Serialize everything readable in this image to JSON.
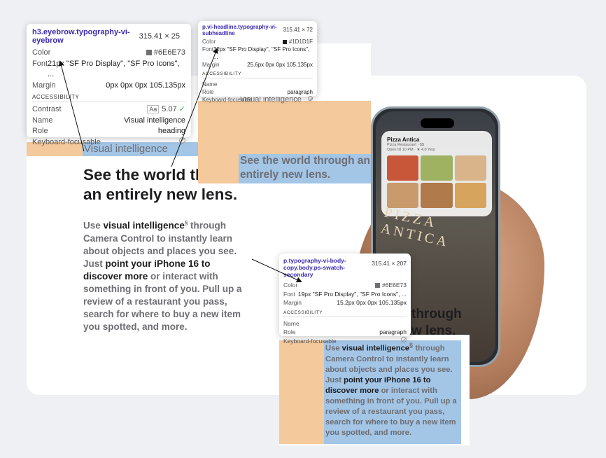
{
  "section": {
    "eyebrow": "Visual intelligence",
    "headline_line1": "See the world through",
    "headline_line2": "an entirely new lens.",
    "body": {
      "use": "Use ",
      "vi": "visual intelligence",
      "footnote": "§",
      "part2": " through Camera Control to instantly learn about objects and places you see. Just ",
      "point": "point your iPhone 16 to discover more",
      "part3": " or interact with something in front of you. Pull up a review of a restaurant you pass, search for where to buy a new item you spotted, and more."
    }
  },
  "phone": {
    "place_name": "Pizza Antica",
    "place_type": "Pizza Restaurant · $$",
    "place_hours": "Open till 10 PM · ★ 4.0 Yelp",
    "sign_text": "PIZZA ANTICA",
    "thumb_colors": [
      "#c8573a",
      "#9fb262",
      "#d9b48a",
      "#c99a6b",
      "#b07a4a",
      "#d7a45e"
    ]
  },
  "preview_head": {
    "eyebrow": "Visual intelligence",
    "headline": "See the world through an entirely new lens."
  },
  "behind_text": {
    "line1": "through",
    "line2": "w lens."
  },
  "tooltips": {
    "eyebrow": {
      "selector": "h3.eyebrow.typography-vi-eyebrow",
      "dims": "315.41 × 25",
      "color_label": "Color",
      "color_value": "#6E6E73",
      "color_hex": "#6E6E73",
      "font_label": "Font",
      "font_value": "21px \"SF Pro Display\", \"SF Pro Icons\", ...",
      "margin_label": "Margin",
      "margin_value": "0px 0px 0px 105.135px",
      "a11y": "ACCESSIBILITY",
      "contrast_label": "Contrast",
      "contrast_aa": "Aa",
      "contrast_value": "5.07",
      "name_label": "Name",
      "name_value": "Visual intelligence",
      "role_label": "Role",
      "role_value": "heading",
      "kbd_label": "Keyboard-focusable"
    },
    "headline": {
      "selector": "p.vi-headline.typography-vi-subheadline",
      "dims": "315.41 × 72",
      "color_label": "Color",
      "color_value": "#1D1D1F",
      "color_hex": "#1D1D1F",
      "font_label": "Font",
      "font_value": "32px \"SF Pro Display\", \"SF Pro Icons\", ...",
      "margin_label": "Margin",
      "margin_value": "25.6px 0px 0px 105.135px",
      "a11y": "ACCESSIBILITY",
      "name_label": "Name",
      "role_label": "Role",
      "role_value": "paragraph",
      "kbd_label": "Keyboard-focusable"
    },
    "body": {
      "selector": "p.typography-vi-body-copy.body.ps-swatch-secondary",
      "dims": "315.41 × 207",
      "color_label": "Color",
      "color_value": "#6E6E73",
      "color_hex": "#6E6E73",
      "font_label": "Font",
      "font_value": "19px \"SF Pro Display\", \"SF Pro Icons\", ...",
      "margin_label": "Margin",
      "margin_value": "15.2px 0px 0px 105.135px",
      "a11y": "ACCESSIBILITY",
      "name_label": "Name",
      "role_label": "Role",
      "role_value": "paragraph",
      "kbd_label": "Keyboard-focusable"
    }
  }
}
